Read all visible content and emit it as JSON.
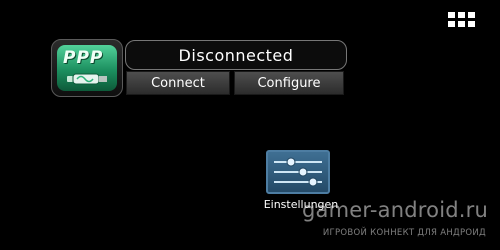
{
  "status": {
    "text": "Disconnected"
  },
  "widget": {
    "icon_text": "PPP",
    "connect_label": "Connect",
    "configure_label": "Configure"
  },
  "shortcut": {
    "label": "Einstellungen"
  },
  "watermark": {
    "main": "gamer-android.ru",
    "sub": "ИГРОВОЙ КОННЕКТ ДЛЯ АНДРОИД"
  },
  "icons": {
    "apps": "apps-grid-icon",
    "ppp": "ppp-widget-icon",
    "settings": "settings-sliders-icon"
  },
  "colors": {
    "background": "#000000",
    "accent": "#3f6f93",
    "ppp_green": "#2fb37a"
  }
}
